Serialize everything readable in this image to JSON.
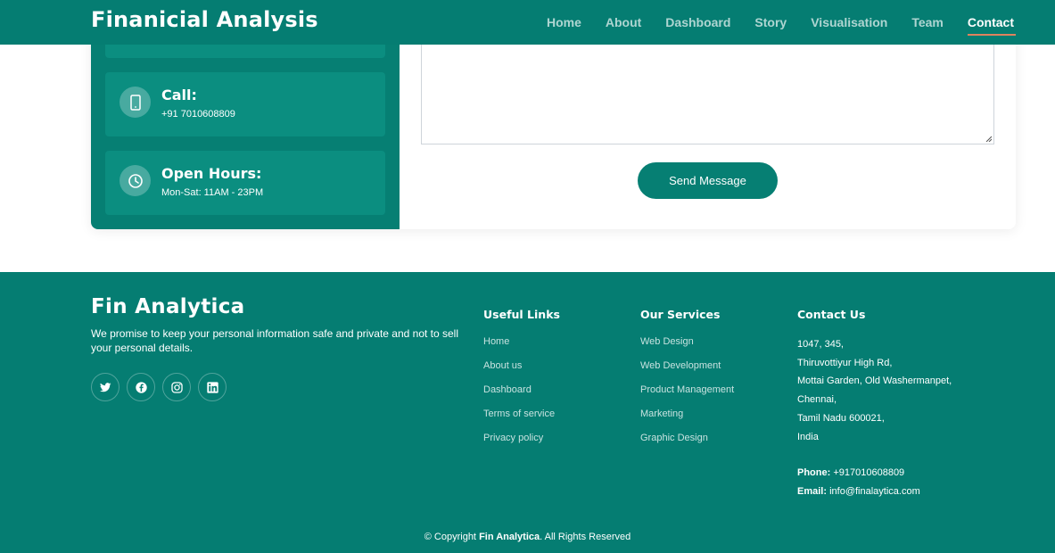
{
  "header": {
    "brand": "Finanicial Analysis",
    "nav": [
      "Home",
      "About",
      "Dashboard",
      "Story",
      "Visualisation",
      "Team",
      "Contact"
    ],
    "active": "Contact"
  },
  "contact": {
    "call": {
      "title": "Call:",
      "text": "+91 7010608809",
      "icon": "smartphone-icon"
    },
    "hours": {
      "title": "Open Hours:",
      "text": "Mon-Sat: 11AM - 23PM",
      "icon": "clock-icon"
    },
    "send_label": "Send Message"
  },
  "footer": {
    "brand": "Fin Analytica",
    "tagline": "We promise to keep your personal information safe and private and not to sell your personal details.",
    "socials": [
      "twitter-icon",
      "facebook-icon",
      "instagram-icon",
      "linkedin-icon"
    ],
    "useful_links": {
      "title": "Useful Links",
      "items": [
        "Home",
        "About us",
        "Dashboard",
        "Terms of service",
        "Privacy policy"
      ]
    },
    "services": {
      "title": "Our Services",
      "items": [
        "Web Design",
        "Web Development",
        "Product Management",
        "Marketing",
        "Graphic Design"
      ]
    },
    "contact": {
      "title": "Contact Us",
      "address": [
        "1047, 345,",
        "Thiruvottiyur High Rd,",
        "Mottai Garden, Old Washermanpet,",
        "Chennai,",
        "Tamil Nadu 600021,",
        "India"
      ],
      "phone_label": "Phone:",
      "phone": "+917010608809",
      "email_label": "Email:",
      "email": "info@finalaytica.com"
    },
    "copyright": {
      "prefix": "© Copyright",
      "brand": "Fin Analytica",
      "suffix": ". All Rights Reserved"
    }
  },
  "colors": {
    "primary": "#057d72",
    "card": "#0b8e80",
    "accent_underline": "#e0825e"
  }
}
